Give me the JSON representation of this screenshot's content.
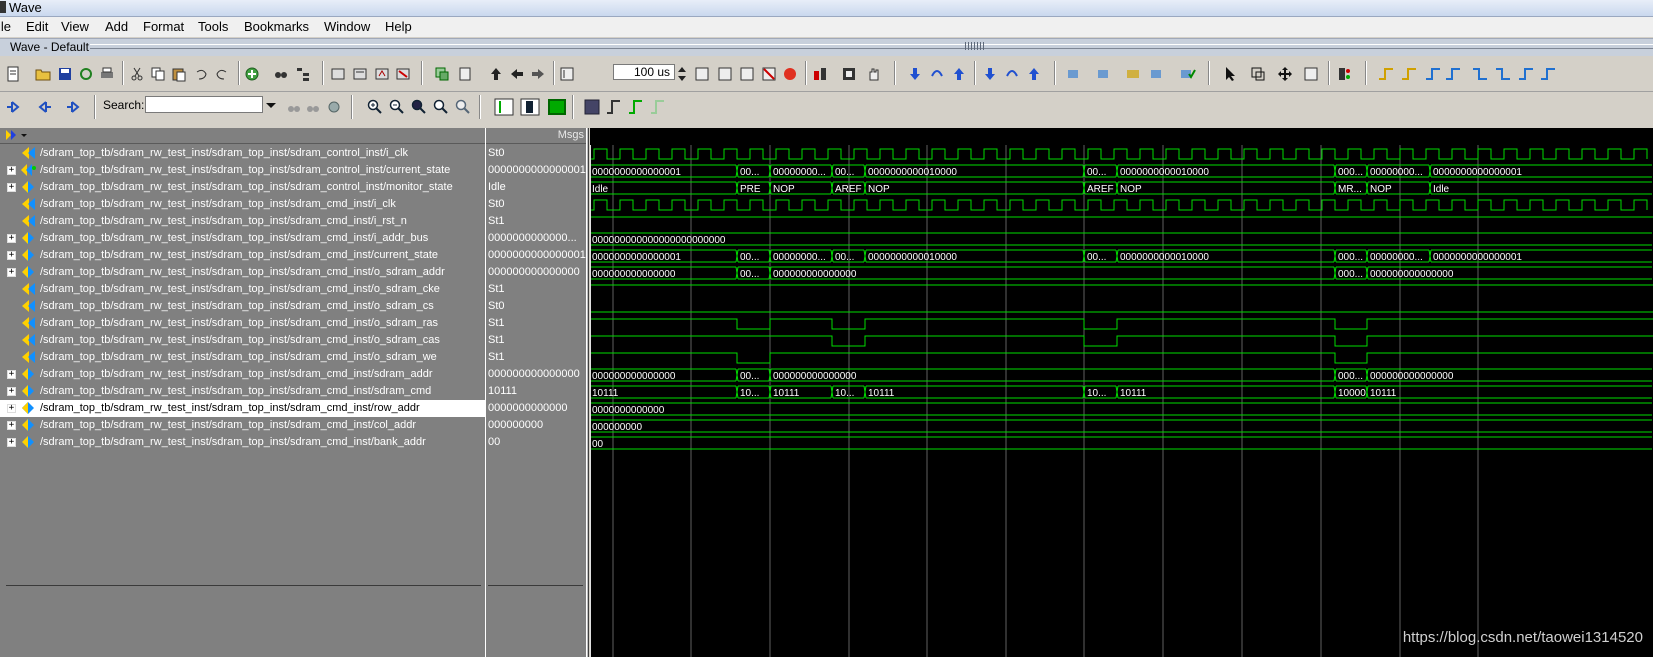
{
  "window": {
    "title": "Wave"
  },
  "menu": [
    "ile",
    "Edit",
    "View",
    "Add",
    "Format",
    "Tools",
    "Bookmarks",
    "Window",
    "Help"
  ],
  "subwindow": {
    "title": "Wave - Default"
  },
  "toolbar": {
    "zoom_value": "100 us",
    "search_label": "Search:",
    "search_value": ""
  },
  "panes": {
    "values_header": "Msgs"
  },
  "signals": [
    {
      "name": "/sdram_top_tb/sdram_rw_test_inst/sdram_top_inst/sdram_control_inst/i_clk",
      "value": "St0",
      "expandable": false,
      "icon": "logic-signal-icon"
    },
    {
      "name": "/sdram_top_tb/sdram_rw_test_inst/sdram_top_inst/sdram_control_inst/current_state",
      "value": "0000000000000001",
      "expandable": true,
      "icon": "state-signal-icon"
    },
    {
      "name": "/sdram_top_tb/sdram_rw_test_inst/sdram_top_inst/sdram_control_inst/monitor_state",
      "value": "Idle",
      "expandable": true,
      "icon": "bus-signal-icon"
    },
    {
      "name": "/sdram_top_tb/sdram_rw_test_inst/sdram_top_inst/sdram_cmd_inst/i_clk",
      "value": "St0",
      "expandable": false,
      "icon": "logic-signal-icon"
    },
    {
      "name": "/sdram_top_tb/sdram_rw_test_inst/sdram_top_inst/sdram_cmd_inst/i_rst_n",
      "value": "St1",
      "expandable": false,
      "icon": "logic-signal-icon"
    },
    {
      "name": "/sdram_top_tb/sdram_rw_test_inst/sdram_top_inst/sdram_cmd_inst/i_addr_bus",
      "value": "0000000000000...",
      "expandable": true,
      "icon": "bus-signal-icon"
    },
    {
      "name": "/sdram_top_tb/sdram_rw_test_inst/sdram_top_inst/sdram_cmd_inst/current_state",
      "value": "0000000000000001",
      "expandable": true,
      "icon": "bus-signal-icon"
    },
    {
      "name": "/sdram_top_tb/sdram_rw_test_inst/sdram_top_inst/sdram_cmd_inst/o_sdram_addr",
      "value": "000000000000000",
      "expandable": true,
      "icon": "bus-signal-icon"
    },
    {
      "name": "/sdram_top_tb/sdram_rw_test_inst/sdram_top_inst/sdram_cmd_inst/o_sdram_cke",
      "value": "St1",
      "expandable": false,
      "icon": "logic-signal-icon"
    },
    {
      "name": "/sdram_top_tb/sdram_rw_test_inst/sdram_top_inst/sdram_cmd_inst/o_sdram_cs",
      "value": "St0",
      "expandable": false,
      "icon": "logic-signal-icon"
    },
    {
      "name": "/sdram_top_tb/sdram_rw_test_inst/sdram_top_inst/sdram_cmd_inst/o_sdram_ras",
      "value": "St1",
      "expandable": false,
      "icon": "logic-signal-icon"
    },
    {
      "name": "/sdram_top_tb/sdram_rw_test_inst/sdram_top_inst/sdram_cmd_inst/o_sdram_cas",
      "value": "St1",
      "expandable": false,
      "icon": "logic-signal-icon"
    },
    {
      "name": "/sdram_top_tb/sdram_rw_test_inst/sdram_top_inst/sdram_cmd_inst/o_sdram_we",
      "value": "St1",
      "expandable": false,
      "icon": "logic-signal-icon"
    },
    {
      "name": "/sdram_top_tb/sdram_rw_test_inst/sdram_top_inst/sdram_cmd_inst/sdram_addr",
      "value": "000000000000000",
      "expandable": true,
      "icon": "bus-signal-icon"
    },
    {
      "name": "/sdram_top_tb/sdram_rw_test_inst/sdram_top_inst/sdram_cmd_inst/sdram_cmd",
      "value": "10111",
      "expandable": true,
      "icon": "bus-signal-icon"
    },
    {
      "name": "/sdram_top_tb/sdram_rw_test_inst/sdram_top_inst/sdram_cmd_inst/row_addr",
      "value": "0000000000000",
      "expandable": true,
      "icon": "bus-signal-icon",
      "selected": true
    },
    {
      "name": "/sdram_top_tb/sdram_rw_test_inst/sdram_top_inst/sdram_cmd_inst/col_addr",
      "value": "000000000",
      "expandable": true,
      "icon": "bus-signal-icon"
    },
    {
      "name": "/sdram_top_tb/sdram_rw_test_inst/sdram_top_inst/sdram_cmd_inst/bank_addr",
      "value": "00",
      "expandable": true,
      "icon": "bus-signal-icon"
    }
  ],
  "bus_labels": {
    "row1": [
      "0000000000000001",
      "00...",
      "00000000...",
      "00...",
      "0000000000010000",
      "00...",
      "0000000000010000",
      "000...",
      "00000000...",
      "0000000000000001"
    ],
    "row2": [
      "Idle",
      "PRE",
      "NOP",
      "AREF",
      "NOP",
      "AREF",
      "NOP",
      "MR...",
      "NOP",
      "Idle"
    ],
    "row5": [
      "000000000000000000000000"
    ],
    "row6": [
      "0000000000000001",
      "00...",
      "00000000...",
      "00...",
      "0000000000010000",
      "00...",
      "0000000000010000",
      "000...",
      "00000000...",
      "0000000000000001"
    ],
    "row7": [
      "000000000000000",
      "00...",
      "000000000000000",
      "000...",
      "000000000000000"
    ],
    "row13": [
      "000000000000000",
      "00...",
      "000000000000000",
      "000...",
      "000000000000000"
    ],
    "row14": [
      "10111",
      "10...",
      "10111",
      "10...",
      "10111",
      "10...",
      "10111",
      "10000",
      "10111"
    ],
    "row15": [
      "0000000000000"
    ],
    "row16": [
      "000000000"
    ],
    "row17": [
      "00"
    ]
  },
  "watermark": "https://blog.csdn.net/taowei1314520",
  "colors": {
    "wave": "#00dd00",
    "wave_bg": "#000000",
    "pane_bg": "#808080",
    "grid": "#606060"
  }
}
